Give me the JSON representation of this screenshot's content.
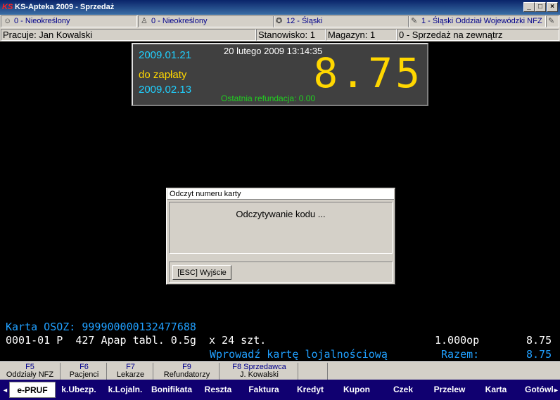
{
  "window": {
    "logo": "KS",
    "title": "KS-Apteka 2009 - Sprzedaż",
    "min": "_",
    "max": "□",
    "close": "×"
  },
  "tabs": [
    {
      "icon": "person-icon",
      "glyph": "☺",
      "label": "0 - Nieokreślony"
    },
    {
      "icon": "doctor-icon",
      "glyph": "♙",
      "label": "0 - Nieokreślony"
    },
    {
      "icon": "region-icon",
      "glyph": "✪",
      "label": "12 - Śląski"
    },
    {
      "icon": "edit-icon",
      "glyph": "✎",
      "label": "1 - Śląski Oddział Wojewódzki NFZ"
    }
  ],
  "info": {
    "user": "Pracuje: Jan Kowalski",
    "station": "Stanowisko: 1",
    "warehouse": "Magazyn: 1",
    "sale_type": "0 - Sprzedaż na zewnątrz"
  },
  "display": {
    "date1": "2009.01.21",
    "to_pay_label": "do zapłaty",
    "date2": "2009.02.13",
    "datetime": "20 lutego 2009  13:14:35",
    "amount": "8.75",
    "refund": "Ostatnia refundacja: 0.00"
  },
  "dialog": {
    "title": "Odczyt numeru karty",
    "message": "Odczytywanie kodu ...",
    "esc_button": "[ESC] Wyjście"
  },
  "terminal": {
    "card": "Karta OSOZ: 999900000132477688",
    "line_item": "0001-01 P  427 Apap tabl. 0.5g  x 24 szt.",
    "quantity": "1.000op",
    "line_total": "8.75",
    "prompt": "Wprowadź kartę lojalnościową",
    "sum_label": "Razem:",
    "sum_total": "8.75"
  },
  "fkeys": [
    {
      "key": "F5",
      "label": "Oddziały NFZ"
    },
    {
      "key": "F6",
      "label": "Pacjenci"
    },
    {
      "key": "F7",
      "label": "Lekarze"
    },
    {
      "key": "F9",
      "label": "Refundatorzy"
    },
    {
      "key": "F8 Sprzedawca",
      "label": "J. Kowalski"
    }
  ],
  "payments": {
    "left_arrow": "◄",
    "right_arrow": "►",
    "items": [
      "e-PRUF",
      "k.Ubezp.",
      "k.Lojaln.",
      "Bonifikata",
      "Reszta",
      "Faktura",
      "Kredyt",
      "Kupon",
      "Czek",
      "Przelew",
      "Karta",
      "Gotówka"
    ],
    "active": "e-PRUF"
  }
}
